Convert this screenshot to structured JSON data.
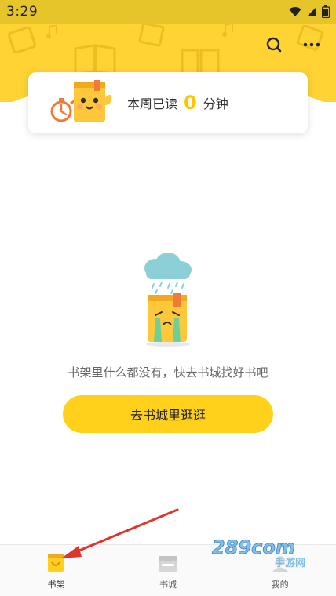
{
  "status_bar": {
    "time": "3:29"
  },
  "header": {
    "search_icon": "search-icon",
    "more_icon": "more-icon"
  },
  "reading_card": {
    "prefix": "本周已读",
    "count": "0",
    "unit": "分钟"
  },
  "empty_state": {
    "message": "书架里什么都没有，快去书城找好书吧",
    "button_label": "去书城里逛逛"
  },
  "bottom_nav": {
    "items": [
      {
        "label": "书架",
        "icon": "bookshelf-icon",
        "active": true
      },
      {
        "label": "书城",
        "icon": "bookstore-icon",
        "active": false
      },
      {
        "label": "我的",
        "icon": "profile-icon",
        "active": false
      }
    ]
  },
  "watermark": {
    "text": "289com",
    "subtext": "手游网"
  },
  "colors": {
    "brand_yellow": "#ffd333",
    "button_yellow": "#ffd11a",
    "count_yellow": "#ffc600",
    "annotation_red": "#e0352b"
  }
}
